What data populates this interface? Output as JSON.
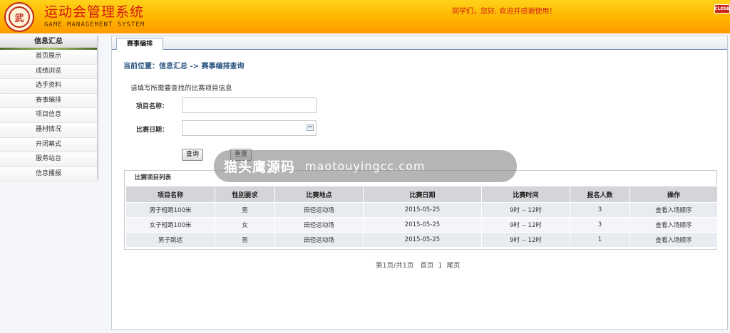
{
  "header": {
    "title": "运动会管理系统",
    "subtitle": "GAME MANAGEMENT SYSTEM",
    "welcome": "同学们，您好, 欢迎并感谢使用！",
    "close_label": "CLOSE",
    "logo_text": "武"
  },
  "sidebar": {
    "title": "信息汇总",
    "items": [
      {
        "label": "首页展示"
      },
      {
        "label": "成绩浏览"
      },
      {
        "label": "选手资料"
      },
      {
        "label": "赛事编排"
      },
      {
        "label": "项目信息"
      },
      {
        "label": "器材情况"
      },
      {
        "label": "开闭幕式"
      },
      {
        "label": "服务站台"
      },
      {
        "label": "信息播报"
      }
    ]
  },
  "main": {
    "tab_label": "赛事编排",
    "breadcrumb": "当前位置：信息汇总 -> 赛事编排查询",
    "form_heading": "请填写所需要查找的比赛项目信息",
    "fields": {
      "name_label": "项目名称：",
      "name_value": "",
      "date_label": "比赛日期：",
      "date_value": ""
    },
    "buttons": {
      "search": "查询",
      "reset": "重置"
    },
    "list": {
      "title": "比赛项目列表",
      "columns": [
        "项目名称",
        "性别要求",
        "比赛地点",
        "比赛日期",
        "比赛时间",
        "报名人数",
        "操作"
      ],
      "rows": [
        [
          "男子短跑100米",
          "男",
          "田径运动场",
          "2015-05-25",
          "9时 -- 12时",
          "3",
          "查看入场顺序"
        ],
        [
          "女子短跑100米",
          "女",
          "田径运动场",
          "2015-05-25",
          "9时 -- 12时",
          "3",
          "查看入场顺序"
        ],
        [
          "男子跳远",
          "男",
          "田径运动场",
          "2015-05-25",
          "9时 -- 12时",
          "1",
          "查看入场顺序"
        ]
      ]
    },
    "pagination": {
      "info": "第1页/共1页",
      "first": "首页",
      "current": "1",
      "last": "尾页"
    }
  },
  "watermark": {
    "cn": "猫头鹰源码",
    "en": "maotouyingcc.com"
  },
  "colors": {
    "header_top": "#ffd21a",
    "header_bottom": "#ff9a00",
    "title_red": "#d11a12",
    "breadcrumb_blue": "#2c5582"
  }
}
